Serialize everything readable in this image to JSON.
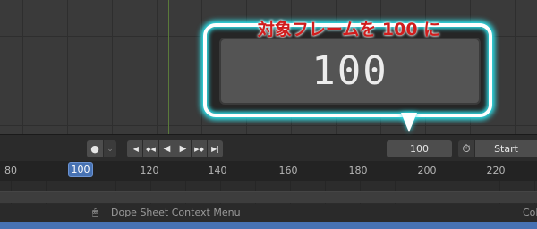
{
  "callout": {
    "title": "対象フレームを 100 に",
    "value": "100"
  },
  "toolbar": {
    "record_icon": "●",
    "record_dropdown_icon": "⌄",
    "jump_start_icon": "|◀",
    "prev_key_icon": "◆◀",
    "play_reverse_icon": "◀",
    "play_icon": "▶",
    "next_key_icon": "▶◆",
    "jump_end_icon": "▶|",
    "current_frame": "100",
    "stopwatch_icon": "⏱",
    "start_label": "Start"
  },
  "ruler": {
    "ticks": [
      "80",
      "100",
      "120",
      "140",
      "160",
      "180",
      "200",
      "220"
    ],
    "current": "100"
  },
  "status": {
    "mouse_icon": "🖱",
    "context_menu": "Dope Sheet Context Menu",
    "right_text": "Col"
  },
  "colors": {
    "accent": "#4772b3",
    "callout_glow": "#2ee6f0",
    "callout_text": "#d11d1d"
  }
}
